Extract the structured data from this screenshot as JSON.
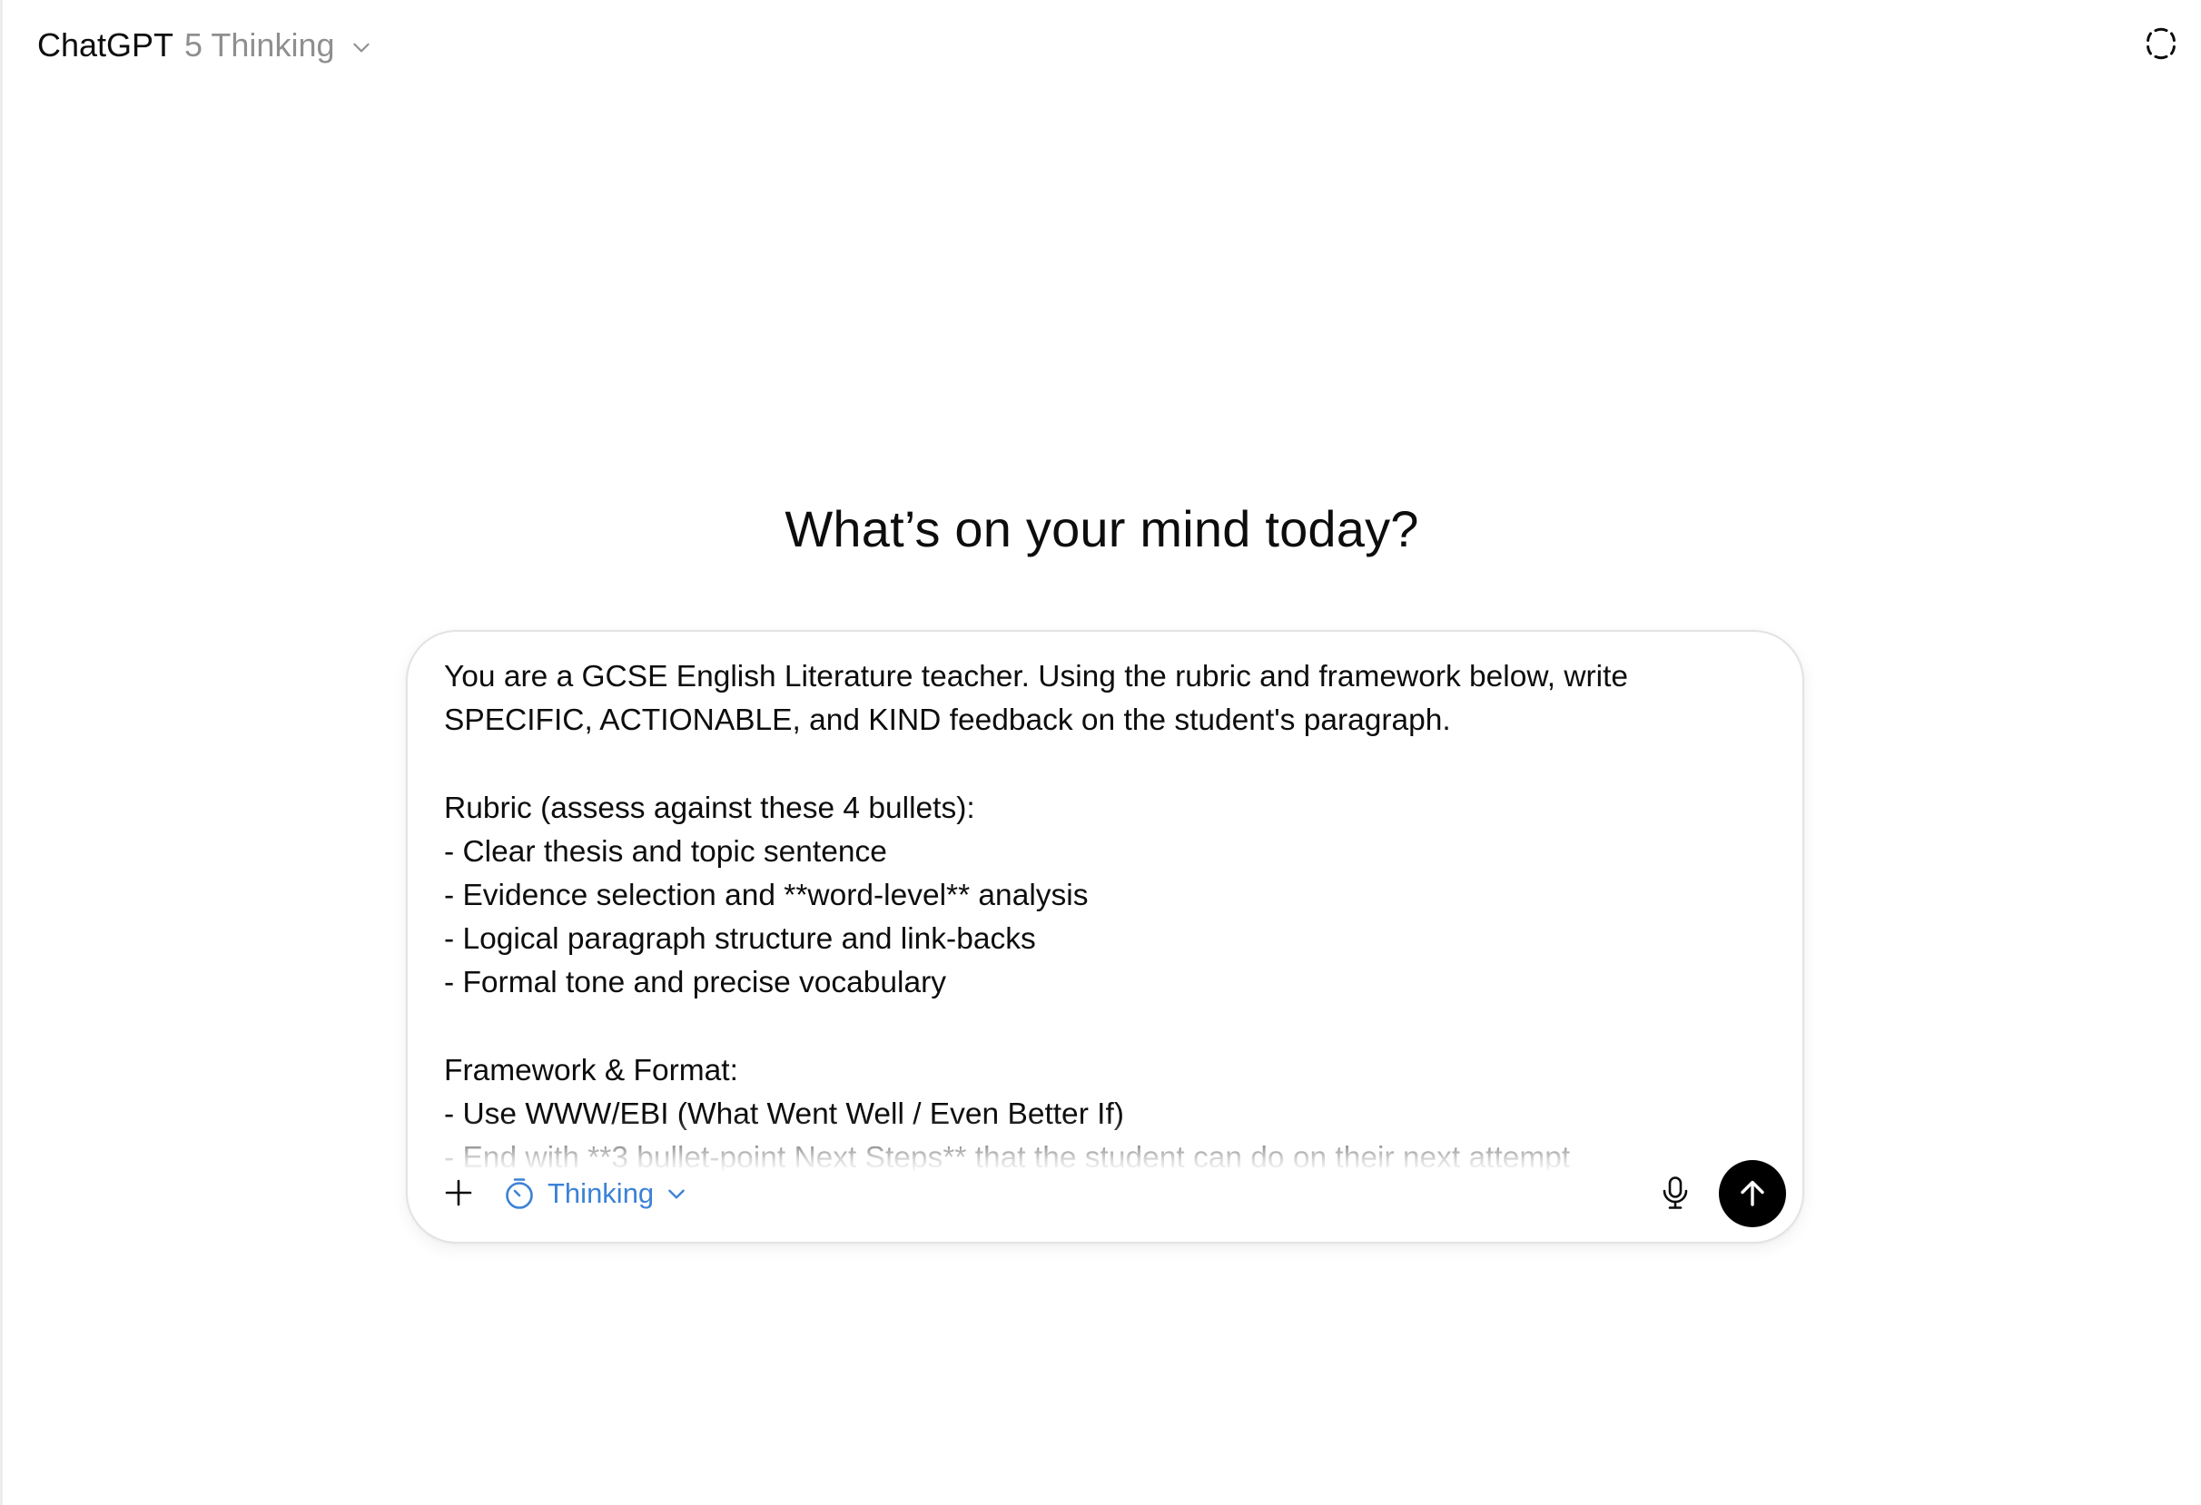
{
  "header": {
    "model_name": "ChatGPT",
    "model_variant": "5 Thinking",
    "model_chevron_icon": "chevron-down-icon",
    "temporary_chat_icon": "dashed-circle-icon"
  },
  "main": {
    "heading": "What’s on your mind today?"
  },
  "composer": {
    "prompt_text": "You are a GCSE English Literature teacher. Using the rubric and framework below, write SPECIFIC, ACTIONABLE, and KIND feedback on the student's paragraph.\n\nRubric (assess against these 4 bullets):\n- Clear thesis and topic sentence\n- Evidence selection and **word-level** analysis\n- Logical paragraph structure and link-backs\n- Formal tone and precise vocabulary\n\nFramework & Format:\n- Use WWW/EBI (What Went Well / Even Better If)\n- End with **3 bullet-point Next Steps** that the student can do on their next attempt",
    "add_icon": "plus-icon",
    "thinking_label": "Thinking",
    "thinking_icon": "stopwatch-icon",
    "thinking_chevron_icon": "chevron-down-icon",
    "mic_icon": "microphone-icon",
    "send_icon": "arrow-up-icon",
    "accent_color": "#3b82d6",
    "send_button_color": "#000000"
  }
}
